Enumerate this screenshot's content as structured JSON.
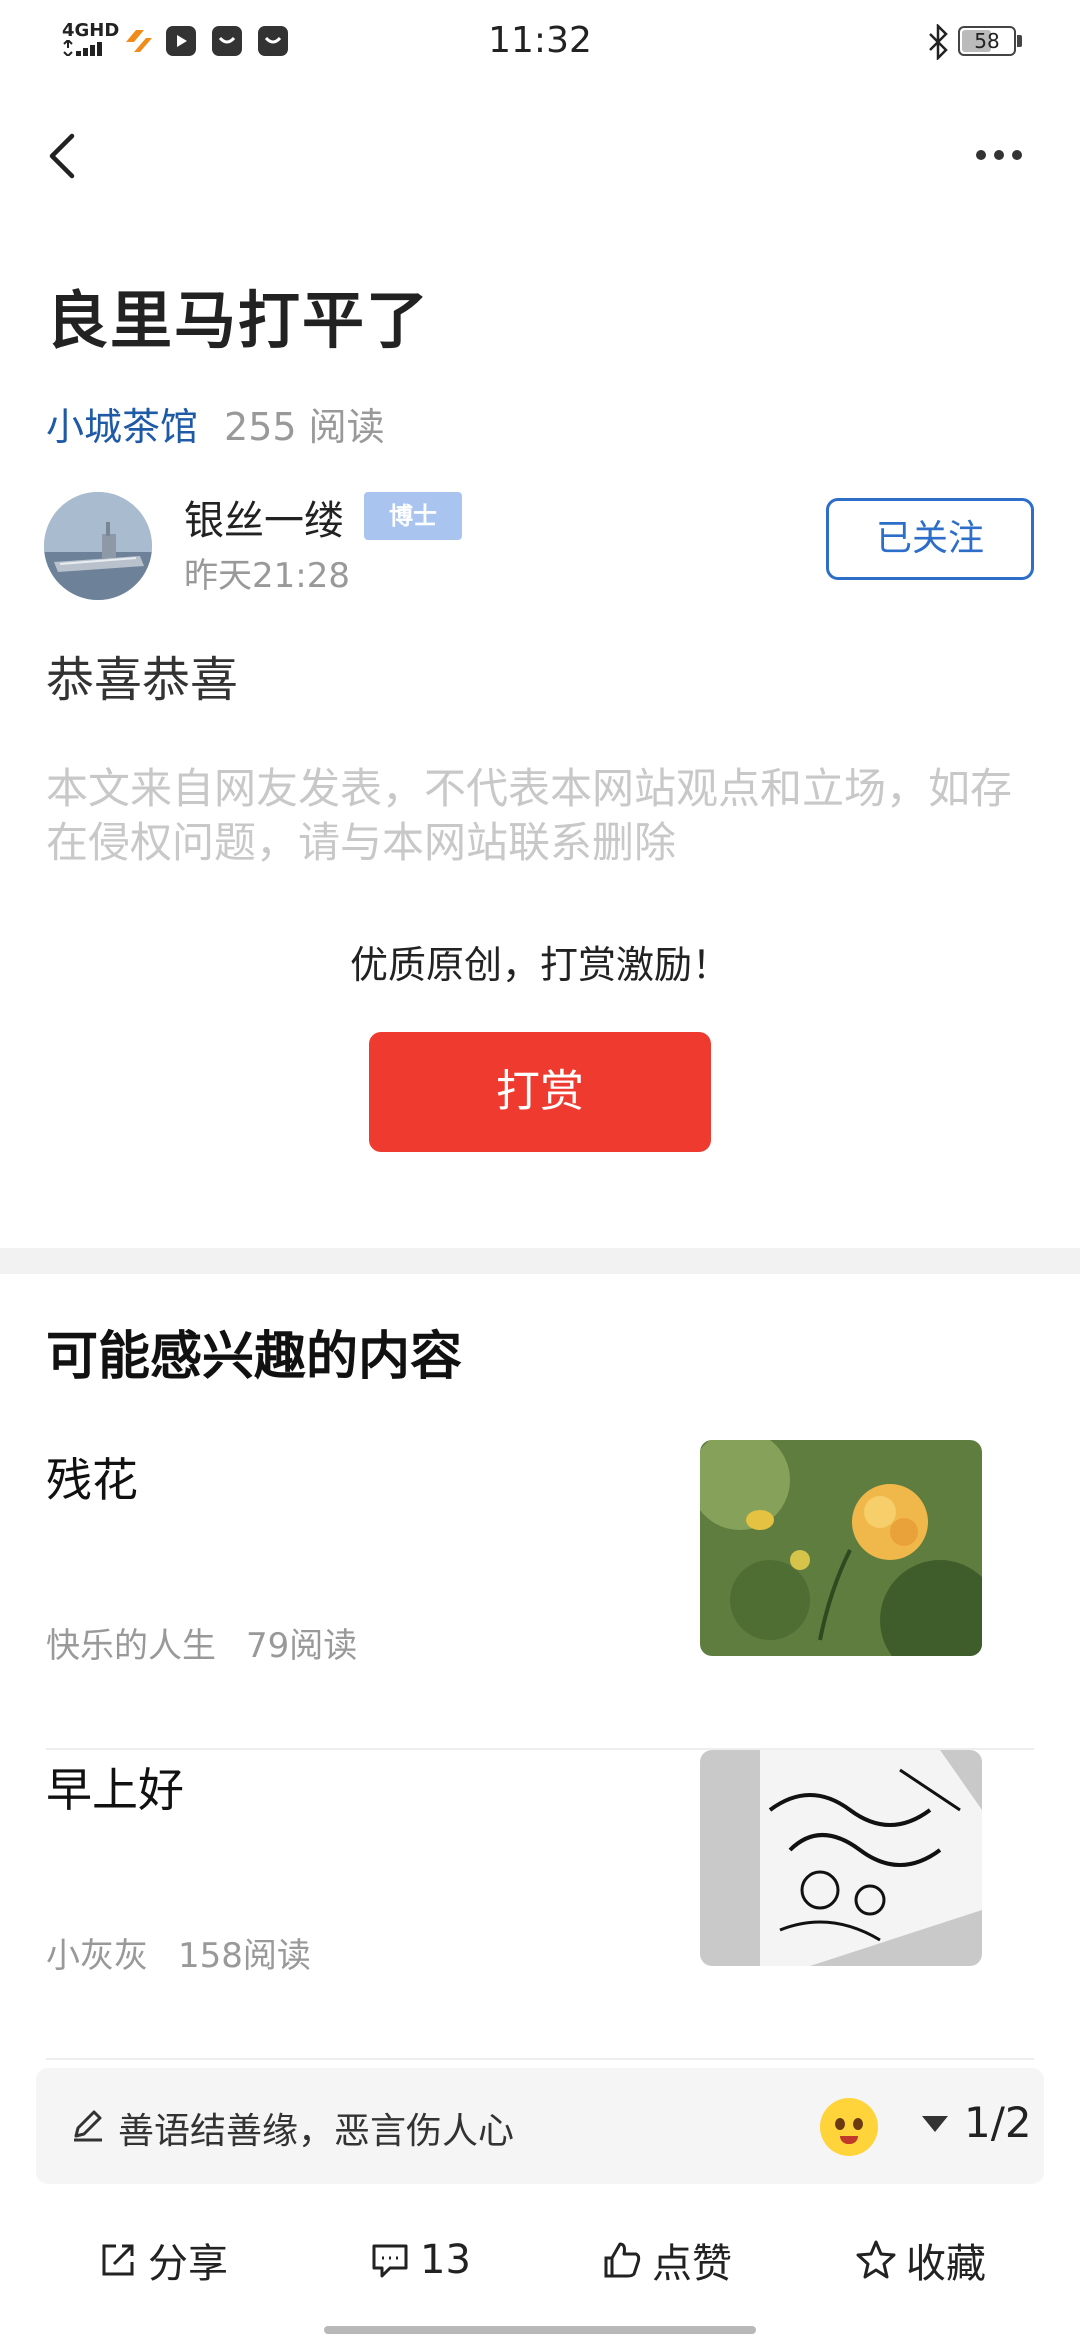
{
  "status_bar": {
    "network": "4GHD",
    "time": "11:32",
    "battery": "58",
    "battery_level": 0.58,
    "icons": [
      "bluetooth-icon",
      "battery-icon",
      "signal-icon",
      "app-notification-icon"
    ]
  },
  "article": {
    "title": "良里马打平了",
    "channel": "小城茶馆",
    "reads": "255 阅读",
    "author": {
      "name": "银丝一缕",
      "badge": "博士",
      "time": "昨天21:28",
      "follow_label": "已关注"
    },
    "body": "恭喜恭喜",
    "disclaimer": "本文来自网友发表，不代表本网站观点和立场，如存在侵权问题，请与本网站联系删除",
    "reward_tip": "优质原创，打赏激励！",
    "reward_button": "打赏"
  },
  "recommendations": {
    "section_title": "可能感兴趣的内容",
    "items": [
      {
        "title": "残花",
        "author": "快乐的人生",
        "reads": "79阅读",
        "thumb": "flower-photo"
      },
      {
        "title": "早上好",
        "author": "小灰灰",
        "reads": "158阅读",
        "thumb": "paper-cut-bird-photo"
      }
    ]
  },
  "comment_bar": {
    "placeholder": "善语结善缘，恶言伤人心",
    "page": "1/2"
  },
  "actions": {
    "share": "分享",
    "comments": "13",
    "like": "点赞",
    "favorite": "收藏"
  },
  "colors": {
    "accent_blue": "#2d6ec8",
    "channel_blue": "#1e5aa6",
    "reward_red": "#ee3a2f",
    "badge_blue": "#a8c4ef"
  }
}
